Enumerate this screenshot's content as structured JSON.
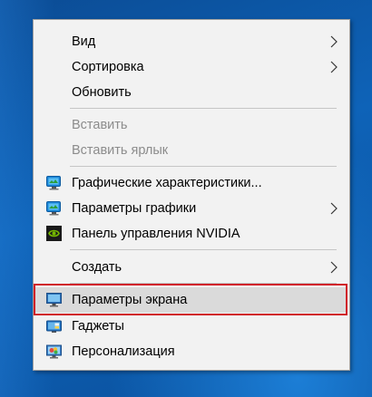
{
  "context_menu": {
    "items": [
      {
        "label": "Вид"
      },
      {
        "label": "Сортировка"
      },
      {
        "label": "Обновить"
      },
      {
        "label": "Вставить"
      },
      {
        "label": "Вставить ярлык"
      },
      {
        "label": "Графические характеристики...",
        "icon": "intel-graphics-icon"
      },
      {
        "label": "Параметры графики",
        "icon": "intel-graphics-icon"
      },
      {
        "label": "Панель управления NVIDIA",
        "icon": "nvidia-icon"
      },
      {
        "label": "Создать"
      },
      {
        "label": "Параметры экрана",
        "icon": "display-icon"
      },
      {
        "label": "Гаджеты",
        "icon": "gadgets-icon"
      },
      {
        "label": "Персонализация",
        "icon": "personalization-icon"
      }
    ]
  },
  "colors": {
    "menu_background": "#f2f2f2",
    "highlight_background": "#dadada",
    "highlight_frame": "#d0202a",
    "disabled_text": "#8c8c8c",
    "desktop_background": "#0a5aa8"
  }
}
